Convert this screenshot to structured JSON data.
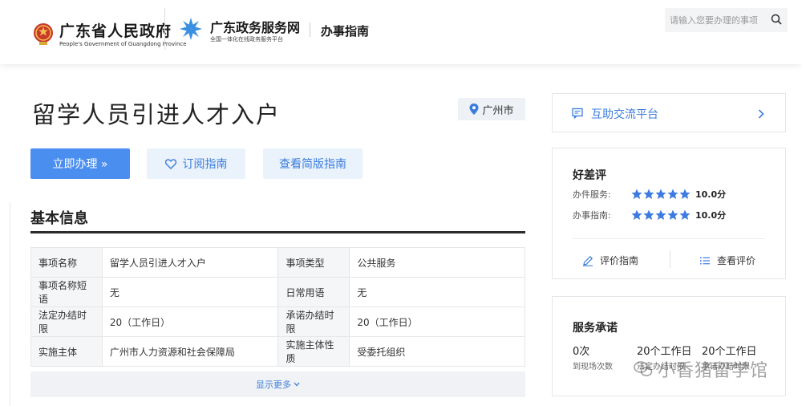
{
  "header": {
    "gov_name": "广东省人民政府",
    "gov_name_en": "People's Government of Guangdong Province",
    "service_name": "广东政务服务网",
    "service_sub": "全国一体化在线政务服务平台",
    "section": "办事指南",
    "search_placeholder": "请输入您要办理的事项"
  },
  "main": {
    "title": "留学人员引进人才入户",
    "location": "广州市",
    "buttons": {
      "apply": "立即办理 »",
      "subscribe": "订阅指南",
      "brief": "查看简版指南"
    },
    "basic_info": {
      "title": "基本信息",
      "rows": [
        [
          "事项名称",
          "留学人员引进人才入户",
          "事项类型",
          "公共服务"
        ],
        [
          "事项名称短语",
          "无",
          "日常用语",
          "无"
        ],
        [
          "法定办结时限",
          "20（工作日）",
          "承诺办结时限",
          "20（工作日）"
        ],
        [
          "实施主体",
          "广州市人力资源和社会保障局",
          "实施主体性质",
          "受委托组织"
        ]
      ],
      "show_more": "显示更多"
    }
  },
  "sidebar": {
    "forum": "互助交流平台",
    "rating": {
      "title": "好差评",
      "items": [
        {
          "label": "办件服务:",
          "stars": 5,
          "score": "10.0分"
        },
        {
          "label": "办事指南:",
          "stars": 5,
          "score": "10.0分"
        }
      ],
      "rate_button": "评价指南",
      "view_button": "查看评价"
    },
    "promise": {
      "title": "服务承诺",
      "values": [
        "0次",
        "20个工作日",
        "20个工作日"
      ],
      "labels": [
        "到现场次数",
        "法定办结时限",
        "承诺办结时限"
      ]
    }
  },
  "watermark": "小香猪留学馆",
  "colors": {
    "accent": "#4a8ef0",
    "link": "#3b7ddd",
    "star": "#3d7be0"
  }
}
